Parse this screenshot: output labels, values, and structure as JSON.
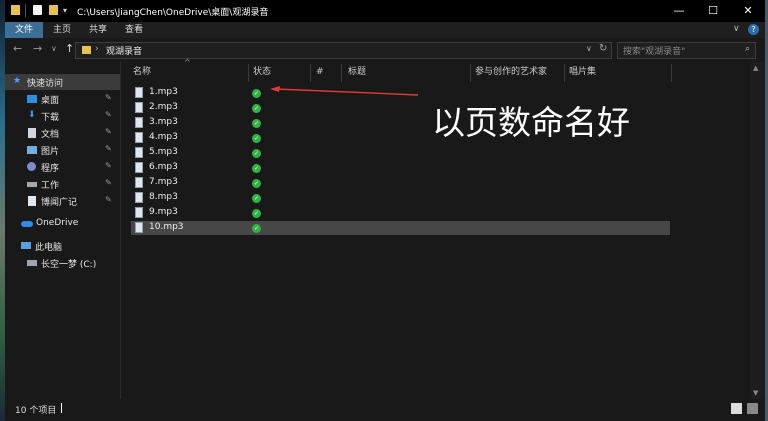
{
  "window": {
    "title_path": "C:\\Users\\JiangChen\\OneDrive\\桌面\\观湖录音",
    "minimize_glyph": "—",
    "maximize_glyph": "☐",
    "close_glyph": "✕"
  },
  "ribbon": {
    "tabs": [
      {
        "label": "文件",
        "active": true
      },
      {
        "label": "主页",
        "active": false
      },
      {
        "label": "共享",
        "active": false
      },
      {
        "label": "查看",
        "active": false
      }
    ],
    "right_chevron": "∨",
    "help_glyph": "?"
  },
  "address": {
    "back_glyph": "←",
    "forward_glyph": "→",
    "recent_glyph": "∨",
    "up_glyph": "↑",
    "sep_glyph": "›",
    "folder": "观湖录音",
    "dropdown_glyph": "∨",
    "refresh_glyph": "↻",
    "search_placeholder": "搜索\"观湖录音\"",
    "search_glyph": "⌕"
  },
  "nav": {
    "items": [
      {
        "label": "快速访问",
        "icon": "star-icon",
        "color": "#4aa3ff",
        "pinned": false,
        "selected": true
      },
      {
        "label": "桌面",
        "icon": "desktop-icon",
        "color": "#2d8fe0",
        "pinned": true,
        "selected": false
      },
      {
        "label": "下载",
        "icon": "download-icon",
        "color": "#3a9be8",
        "pinned": true,
        "selected": false
      },
      {
        "label": "文档",
        "icon": "documents-icon",
        "color": "#cfd8e0",
        "pinned": true,
        "selected": false
      },
      {
        "label": "图片",
        "icon": "pictures-icon",
        "color": "#6fb0e0",
        "pinned": true,
        "selected": false
      },
      {
        "label": "程序",
        "icon": "program-icon",
        "color": "#7c8ccc",
        "pinned": true,
        "selected": false
      },
      {
        "label": "工作",
        "icon": "work-drive-icon",
        "color": "#a0a8b0",
        "pinned": true,
        "selected": false
      },
      {
        "label": "博闻广记",
        "icon": "file-icon",
        "color": "#dfe6ee",
        "pinned": true,
        "selected": false
      },
      {
        "label": "OneDrive",
        "icon": "onedrive-icon",
        "color": "#2e8ae6",
        "pinned": false,
        "selected": false
      },
      {
        "label": "此电脑",
        "icon": "this-pc-icon",
        "color": "#5aa0e0",
        "pinned": false,
        "selected": false
      },
      {
        "label": "长空一梦 (C:)",
        "icon": "drive-c-icon",
        "color": "#9aa4ae",
        "pinned": false,
        "selected": false
      }
    ],
    "pin_glyph": "📌"
  },
  "columns": [
    {
      "key": "name",
      "label": "名称"
    },
    {
      "key": "status",
      "label": "状态"
    },
    {
      "key": "number",
      "label": "#"
    },
    {
      "key": "title",
      "label": "标题"
    },
    {
      "key": "artist",
      "label": "参与创作的艺术家"
    },
    {
      "key": "album",
      "label": "唱片集"
    }
  ],
  "sort_glyph": "^",
  "files": [
    {
      "name": "1.mp3",
      "selected": false
    },
    {
      "name": "2.mp3",
      "selected": false
    },
    {
      "name": "3.mp3",
      "selected": false
    },
    {
      "name": "4.mp3",
      "selected": false
    },
    {
      "name": "5.mp3",
      "selected": false
    },
    {
      "name": "6.mp3",
      "selected": false
    },
    {
      "name": "7.mp3",
      "selected": false
    },
    {
      "name": "8.mp3",
      "selected": false
    },
    {
      "name": "9.mp3",
      "selected": false
    },
    {
      "name": "10.mp3",
      "selected": true
    }
  ],
  "status_check_glyph": "✓",
  "annotation": {
    "text": "以页数命名好",
    "arrow_color": "#e23a3a"
  },
  "statusbar": {
    "item_count": "10 个项目"
  }
}
